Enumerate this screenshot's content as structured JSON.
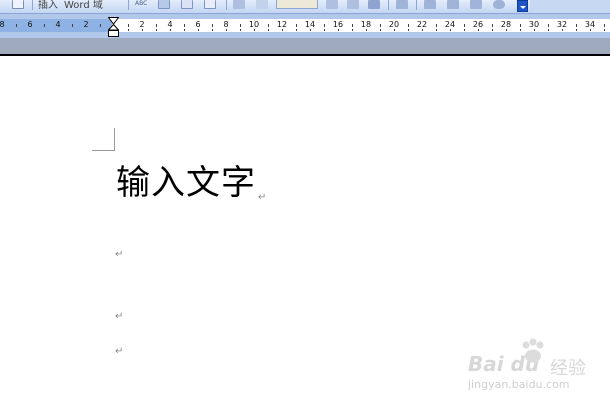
{
  "toolbar": {
    "insert_field_label": "插入",
    "word_field_label": "Word 域",
    "dropdown_icon": "chevron-down-icon",
    "accent_color": "#1f56c5"
  },
  "ruler": {
    "left_labels": [
      "8",
      "6",
      "4",
      "2"
    ],
    "right_labels": [
      "2",
      "4",
      "6",
      "8",
      "10",
      "12",
      "14",
      "16",
      "18",
      "20",
      "22",
      "24",
      "26",
      "28",
      "30",
      "32",
      "34"
    ],
    "margin_color": "#8fb2e4",
    "page_color": "#ffffff"
  },
  "document": {
    "heading": "输入文字",
    "paragraph_mark": "↵"
  },
  "watermark": {
    "brand": "Bai du",
    "brand_suffix": "经验",
    "url": "jingyan.baidu.com"
  }
}
